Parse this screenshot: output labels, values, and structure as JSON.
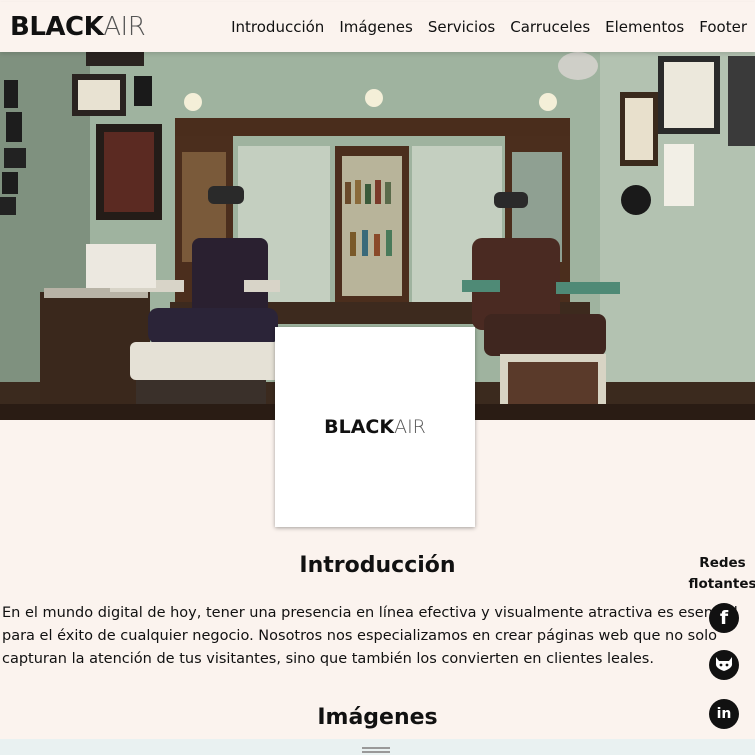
{
  "brand": {
    "bold": "BLACK",
    "light": "AIR"
  },
  "nav": {
    "items": [
      {
        "label": "Introducción"
      },
      {
        "label": "Imágenes"
      },
      {
        "label": "Servicios"
      },
      {
        "label": "Carruceles"
      },
      {
        "label": "Elementos"
      },
      {
        "label": "Footer"
      }
    ]
  },
  "hero": {
    "image": "barbershop-interior"
  },
  "intro": {
    "title": "Introducción",
    "paragraph": "En el mundo digital de hoy, tener una presencia en línea efectiva y visualmente atractiva es esencial para el éxito de cualquier negocio. Nosotros nos especializamos en crear páginas web que no solo capturan la atención de tus visitantes, sino que también los convierten en clientes leales."
  },
  "images_section": {
    "title": "Imágenes"
  },
  "social": {
    "title": "Redes flotantes",
    "icons": [
      "facebook-icon",
      "github-icon",
      "linkedin-icon"
    ]
  },
  "colors": {
    "background": "#fbf3ee",
    "text": "#111111",
    "card": "#ffffff"
  }
}
